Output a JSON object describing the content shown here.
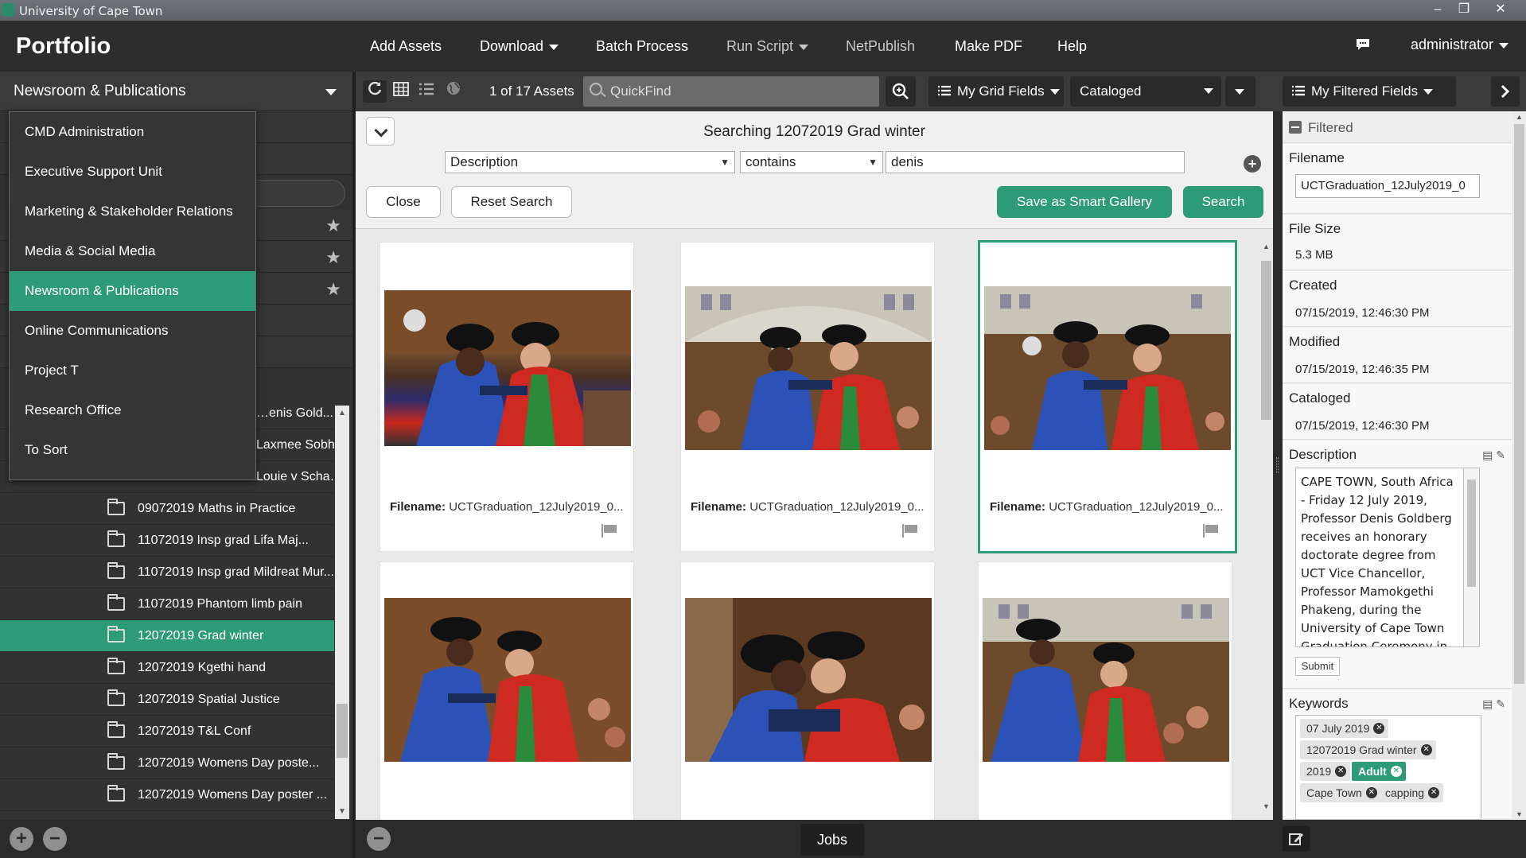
{
  "window": {
    "title": "University of Cape Town",
    "controls": [
      "–",
      "❐",
      "✕"
    ]
  },
  "app": {
    "name": "Portfolio"
  },
  "nav": {
    "add_assets": "Add Assets",
    "download": "Download",
    "batch_process": "Batch Process",
    "run_script": "Run Script",
    "netpublish": "NetPublish",
    "make_pdf": "Make PDF",
    "help": "Help",
    "user": "administrator"
  },
  "catalog": {
    "selected": "Newsroom & Publications",
    "menu": [
      "CMD Administration",
      "Executive Support Unit",
      "Marketing & Stakeholder Relations",
      "Media & Social Media",
      "Newsroom & Publications",
      "Online Communications",
      "Project T",
      "Research Office",
      "To Sort"
    ]
  },
  "galleries": {
    "partial": [
      "…enis Gold...",
      "Laxmee Sobh…",
      "Louie v Scha…"
    ],
    "folders": [
      "09072019 Maths in Practice",
      "11072019 Insp grad Lifa Maj...",
      "11072019 Insp grad Mildreat Mur...",
      "11072019 Phantom limb pain",
      "12072019 Grad winter",
      "12072019 Kgethi hand",
      "12072019 Spatial Justice",
      "12072019 T&L Conf",
      "12072019 Womens Day poste...",
      "12072019 Womens Day poster ..."
    ],
    "selected_index": 4
  },
  "toolbar": {
    "asset_count": "1 of 17 Assets",
    "quickfind_placeholder": "QuickFind",
    "grid_fields": "My Grid Fields",
    "status": "Cataloged",
    "filtered_fields": "My Filtered Fields"
  },
  "search": {
    "title": "Searching 12072019 Grad winter",
    "field": "Description",
    "operator": "contains",
    "value": "denis",
    "close": "Close",
    "reset": "Reset Search",
    "save_smart": "Save as Smart Gallery",
    "search": "Search"
  },
  "assets": {
    "filename_label": "Filename:",
    "cards": [
      {
        "filename": "UCTGraduation_12July2019_0..."
      },
      {
        "filename": "UCTGraduation_12July2019_0..."
      },
      {
        "filename": "UCTGraduation_12July2019_0...",
        "selected": true
      },
      {
        "filename": ""
      },
      {
        "filename": ""
      },
      {
        "filename": ""
      }
    ]
  },
  "footer": {
    "jobs": "Jobs"
  },
  "details": {
    "filtered": "Filtered",
    "filename_label": "Filename",
    "filename": "UCTGraduation_12July2019_0",
    "filesize_label": "File Size",
    "filesize": "5.3 MB",
    "created_label": "Created",
    "created": "07/15/2019, 12:46:30 PM",
    "modified_label": "Modified",
    "modified": "07/15/2019, 12:46:35 PM",
    "cataloged_label": "Cataloged",
    "cataloged": "07/15/2019, 12:46:30 PM",
    "description_label": "Description",
    "description": "CAPE TOWN, South Africa - Friday 12 July 2019, Professor Denis Goldberg receives an honorary doctorate degree from UCT Vice Chancellor, Professor Mamokgethi Phakeng, during the University of Cape Town Graduation Ceremony in the Sarah Baartman Hall at Upper",
    "submit": "Submit",
    "keywords_label": "Keywords",
    "keywords": [
      "07 July 2019",
      "12072019 Grad winter",
      "2019",
      "Adult",
      "Cape Town",
      "capping"
    ]
  },
  "colors": {
    "accent": "#2d9b78",
    "nav_bg": "#2d2d2d",
    "panel_bg": "#323232"
  }
}
